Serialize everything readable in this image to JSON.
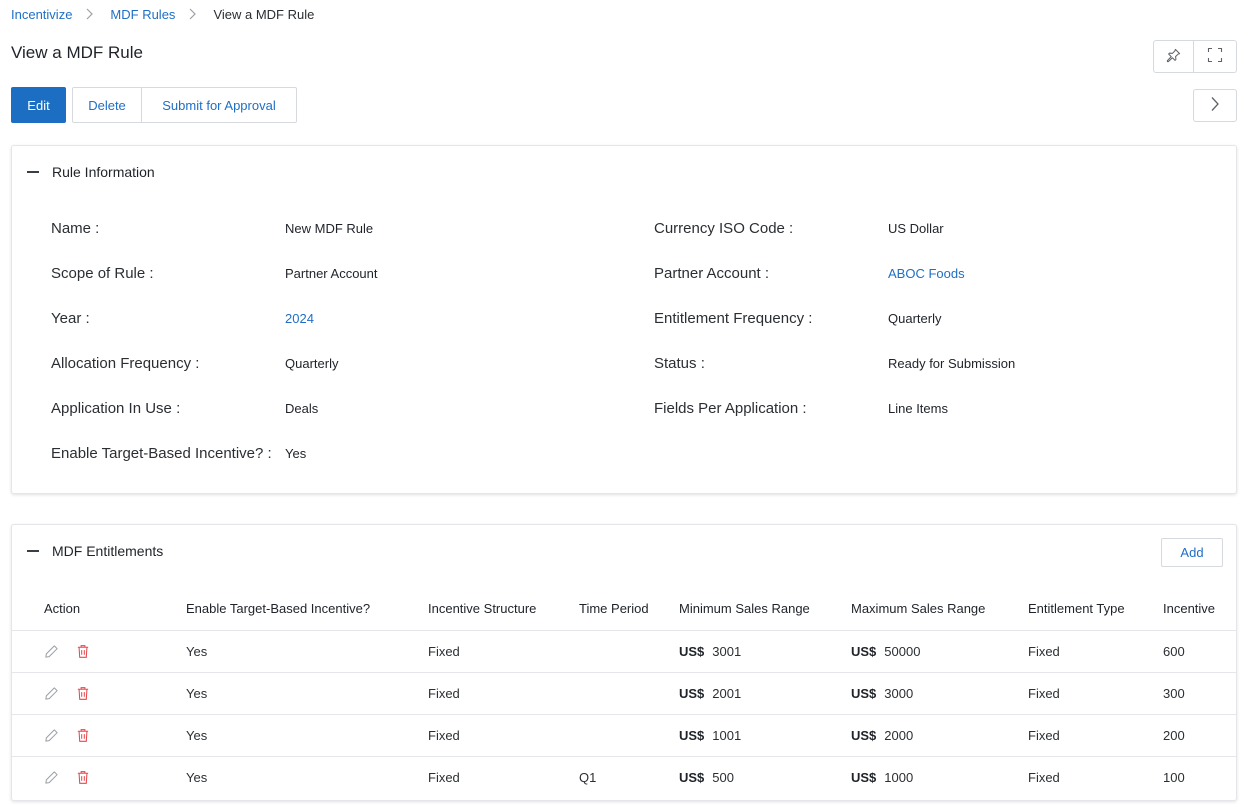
{
  "breadcrumb": {
    "items": [
      "Incentivize",
      "MDF Rules"
    ],
    "current": "View a MDF Rule"
  },
  "page": {
    "title": "View a MDF Rule"
  },
  "actions": {
    "edit": "Edit",
    "delete": "Delete",
    "submit": "Submit for Approval"
  },
  "rule_info": {
    "title": "Rule Information",
    "left": [
      {
        "label": "Name :",
        "value": "New MDF Rule"
      },
      {
        "label": "Scope of Rule :",
        "value": "Partner Account"
      },
      {
        "label": "Year :",
        "value": "2024"
      },
      {
        "label": "Allocation Frequency :",
        "value": "Quarterly"
      },
      {
        "label": "Application In Use :",
        "value": "Deals"
      },
      {
        "label": "Enable Target-Based Incentive? :",
        "value": "Yes"
      }
    ],
    "right": [
      {
        "label": "Currency ISO Code :",
        "value": "US Dollar"
      },
      {
        "label": "Partner Account :",
        "value": "ABOC Foods"
      },
      {
        "label": "Entitlement Frequency :",
        "value": "Quarterly"
      },
      {
        "label": "Status :",
        "value": "Ready for Submission"
      },
      {
        "label": "Fields Per Application :",
        "value": "Line Items"
      }
    ]
  },
  "entitlements": {
    "title": "MDF Entitlements",
    "add_label": "Add",
    "columns": [
      "Action",
      "Enable Target-Based Incentive?",
      "Incentive Structure",
      "Time Period",
      "Minimum Sales Range",
      "Maximum Sales Range",
      "Entitlement Type",
      "Incentive"
    ],
    "currency_symbol": "US$",
    "rows": [
      {
        "target": "Yes",
        "structure": "Fixed",
        "period": "",
        "min": "3001",
        "max": "50000",
        "type": "Fixed",
        "incentive": "600"
      },
      {
        "target": "Yes",
        "structure": "Fixed",
        "period": "",
        "min": "2001",
        "max": "3000",
        "type": "Fixed",
        "incentive": "300"
      },
      {
        "target": "Yes",
        "structure": "Fixed",
        "period": "",
        "min": "1001",
        "max": "2000",
        "type": "Fixed",
        "incentive": "200"
      },
      {
        "target": "Yes",
        "structure": "Fixed",
        "period": "Q1",
        "min": "500",
        "max": "1000",
        "type": "Fixed",
        "incentive": "100"
      }
    ]
  },
  "icons": {
    "pin": "pin-icon",
    "expand": "expand-icon",
    "next": "chevron-right-icon",
    "edit": "pencil-icon",
    "delete": "trash-icon"
  },
  "colors": {
    "primary": "#1b6ec2",
    "link": "#1f6fc5",
    "delete": "#e5484d"
  }
}
